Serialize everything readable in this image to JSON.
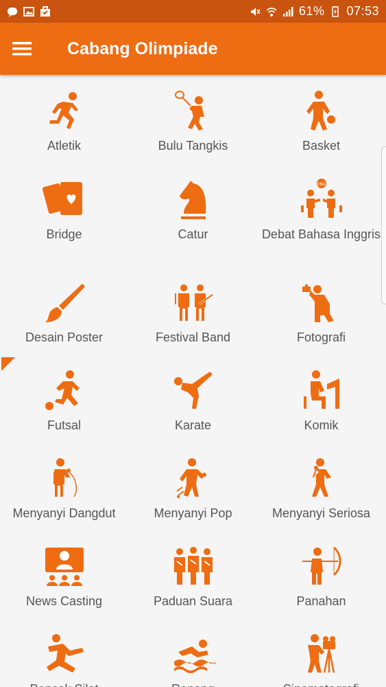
{
  "status_bar": {
    "battery_percent": "61%",
    "time": "07:53",
    "left_icons": [
      "line-app-icon",
      "gallery-icon",
      "briefcase-icon"
    ],
    "right_icons": [
      "mute-icon",
      "wifi-icon",
      "signal-icon",
      "battery-icon"
    ]
  },
  "app_bar": {
    "title": "Cabang Olimpiade",
    "menu_icon": "hamburger-menu-icon"
  },
  "colors": {
    "accent": "#ee6c12",
    "status_bar": "#c8540f",
    "label_text": "#555555",
    "background": "#f5f5f5"
  },
  "categories": [
    {
      "label": "Atletik",
      "icon": "running-icon"
    },
    {
      "label": "Bulu Tangkis",
      "icon": "badminton-icon"
    },
    {
      "label": "Basket",
      "icon": "basketball-icon"
    },
    {
      "label": "Bridge",
      "icon": "playing-cards-icon"
    },
    {
      "label": "Catur",
      "icon": "chess-knight-icon"
    },
    {
      "label": "Debat Bahasa Inggris",
      "icon": "debate-icon"
    },
    {
      "label": "Desain Poster",
      "icon": "paintbrush-icon"
    },
    {
      "label": "Festival Band",
      "icon": "band-icon"
    },
    {
      "label": "Fotografi",
      "icon": "photographer-icon"
    },
    {
      "label": "Futsal",
      "icon": "futsal-icon"
    },
    {
      "label": "Karate",
      "icon": "karate-icon"
    },
    {
      "label": "Komik",
      "icon": "comic-artist-icon"
    },
    {
      "label": "Menyanyi Dangdut",
      "icon": "singer-dangdut-icon"
    },
    {
      "label": "Menyanyi Pop",
      "icon": "singer-pop-icon"
    },
    {
      "label": "Menyanyi Seriosa",
      "icon": "singer-seriosa-icon"
    },
    {
      "label": "News Casting",
      "icon": "news-anchor-icon"
    },
    {
      "label": "Paduan Suara",
      "icon": "choir-icon"
    },
    {
      "label": "Panahan",
      "icon": "archery-icon"
    },
    {
      "label": "Pencak Silat",
      "icon": "martial-arts-icon"
    },
    {
      "label": "Renang",
      "icon": "swimming-icon"
    },
    {
      "label": "Sinematografi",
      "icon": "cinematography-icon"
    }
  ]
}
